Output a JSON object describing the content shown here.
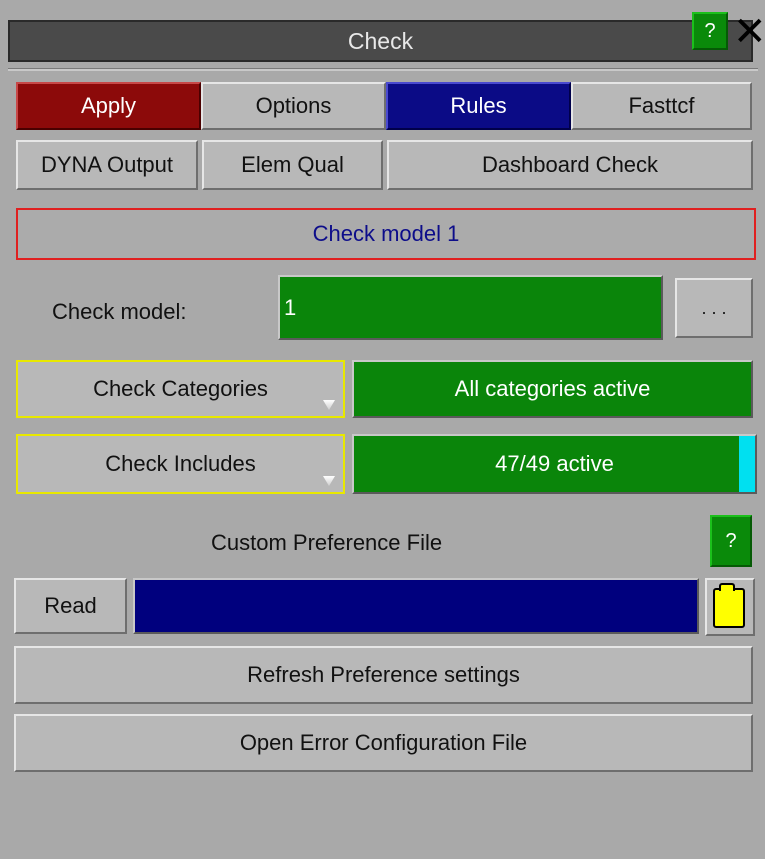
{
  "window": {
    "title": "Check",
    "help_label": "?",
    "close_label": "✕"
  },
  "tabs": [
    {
      "label": "Apply",
      "color": "#8c0a0a"
    },
    {
      "label": "Options"
    },
    {
      "label": "Rules",
      "color": "#0b0b86"
    },
    {
      "label": "Fasttcf"
    }
  ],
  "tools": [
    {
      "label": "DYNA Output"
    },
    {
      "label": "Elem Qual"
    },
    {
      "label": "Dashboard Check"
    }
  ],
  "status": {
    "text": "Check model 1"
  },
  "check_model": {
    "label": "Check model:",
    "value": "1",
    "more_label": ". . ."
  },
  "categories": {
    "label": "Check Categories",
    "status": "All categories active"
  },
  "includes": {
    "label": "Check Includes",
    "status": "47/49 active",
    "active": 47,
    "total": 49
  },
  "preference": {
    "title": "Custom Preference File",
    "help_label": "?",
    "read_label": "Read",
    "file_value": "",
    "folder_icon": "folder-icon"
  },
  "actions": {
    "refresh_label": "Refresh Preference settings",
    "open_error_label": "Open Error Configuration File"
  }
}
